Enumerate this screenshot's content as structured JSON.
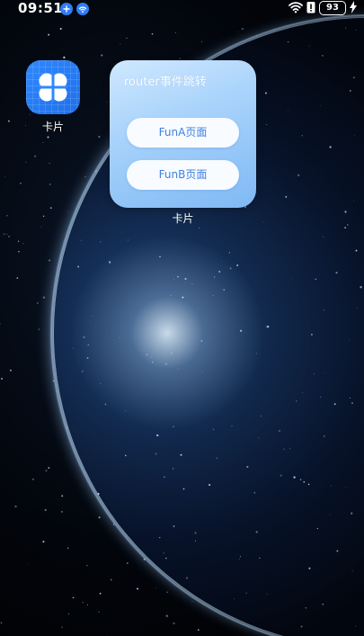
{
  "status_bar": {
    "time": "09:51",
    "battery": "93",
    "icons": [
      "usb-icon",
      "wifi-app-icon",
      "wifi-icon",
      "alert-icon",
      "battery-icon",
      "charging-icon"
    ]
  },
  "home_app": {
    "label": "卡片",
    "icon": "card-app-icon",
    "icon_color": "#2a82fb"
  },
  "widget": {
    "title": "router事件跳转",
    "button_a": "FunA页面",
    "button_b": "FunB页面",
    "label": "卡片",
    "button_text_color": "#3d82e0",
    "background_color": "#a9d3fb"
  }
}
